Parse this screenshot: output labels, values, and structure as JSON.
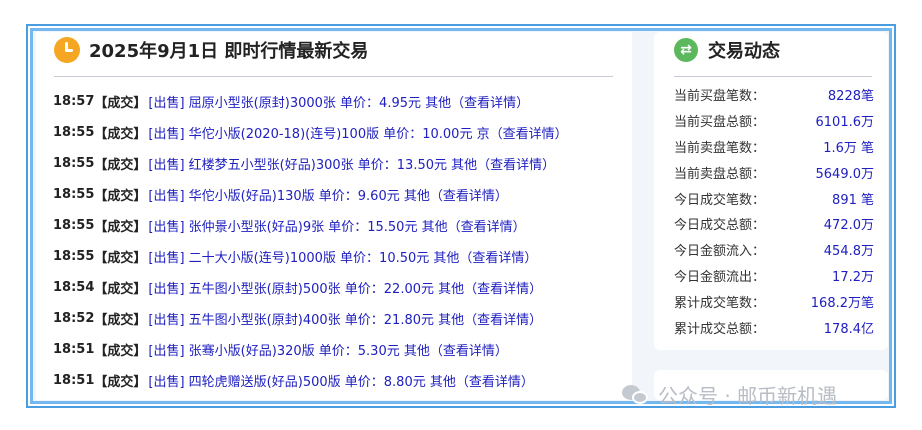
{
  "left": {
    "title": "2025年9月1日 即时行情最新交易",
    "trades": [
      {
        "time": "18:57",
        "status": "【成交】",
        "text": "[出售] 屈原小型张(原封)3000张 单价：4.95元 其他（查看详情）"
      },
      {
        "time": "18:55",
        "status": "【成交】",
        "text": "[出售] 华佗小版(2020-18)(连号)100版 单价：10.00元 京（查看详情）"
      },
      {
        "time": "18:55",
        "status": "【成交】",
        "text": "[出售] 红楼梦五小型张(好品)300张 单价：13.50元 其他（查看详情）"
      },
      {
        "time": "18:55",
        "status": "【成交】",
        "text": "[出售] 华佗小版(好品)130版 单价：9.60元 其他（查看详情）"
      },
      {
        "time": "18:55",
        "status": "【成交】",
        "text": "[出售] 张仲景小型张(好品)9张 单价：15.50元 其他（查看详情）"
      },
      {
        "time": "18:55",
        "status": "【成交】",
        "text": "[出售] 二十大小版(连号)1000版 单价：10.50元 其他（查看详情）"
      },
      {
        "time": "18:54",
        "status": "【成交】",
        "text": "[出售] 五牛图小型张(原封)500张 单价：22.00元 其他（查看详情）"
      },
      {
        "time": "18:52",
        "status": "【成交】",
        "text": "[出售] 五牛图小型张(原封)400张 单价：21.80元 其他（查看详情）"
      },
      {
        "time": "18:51",
        "status": "【成交】",
        "text": "[出售] 张骞小版(好品)320版 单价：5.30元 其他（查看详情）"
      },
      {
        "time": "18:51",
        "status": "【成交】",
        "text": "[出售] 四轮虎赠送版(好品)500版 单价：8.80元 其他（查看详情）"
      }
    ]
  },
  "right": {
    "title": "交易动态",
    "stats": [
      {
        "label": "当前买盘笔数：",
        "value": "8228笔"
      },
      {
        "label": "当前买盘总额：",
        "value": "6101.6万"
      },
      {
        "label": "当前卖盘笔数：",
        "value": "1.6万 笔"
      },
      {
        "label": "当前卖盘总额：",
        "value": "5649.0万"
      },
      {
        "label": "今日成交笔数：",
        "value": "891 笔"
      },
      {
        "label": "今日成交总额：",
        "value": "472.0万"
      },
      {
        "label": "今日金额流入：",
        "value": "454.8万"
      },
      {
        "label": "今日金额流出：",
        "value": "17.2万"
      },
      {
        "label": "累计成交笔数：",
        "value": "168.2万笔"
      },
      {
        "label": "累计成交总额：",
        "value": "178.4亿"
      }
    ]
  },
  "watermark": {
    "text": "公众号 · 邮币新机遇"
  },
  "icons": {
    "left_title": "clock-icon",
    "right_title": "exchange-icon",
    "watermark": "wechat-icon"
  },
  "colors": {
    "link": "#2020c0",
    "frame": "#4a9de0",
    "clock": "#f5a623",
    "exchange": "#5cb85c"
  }
}
